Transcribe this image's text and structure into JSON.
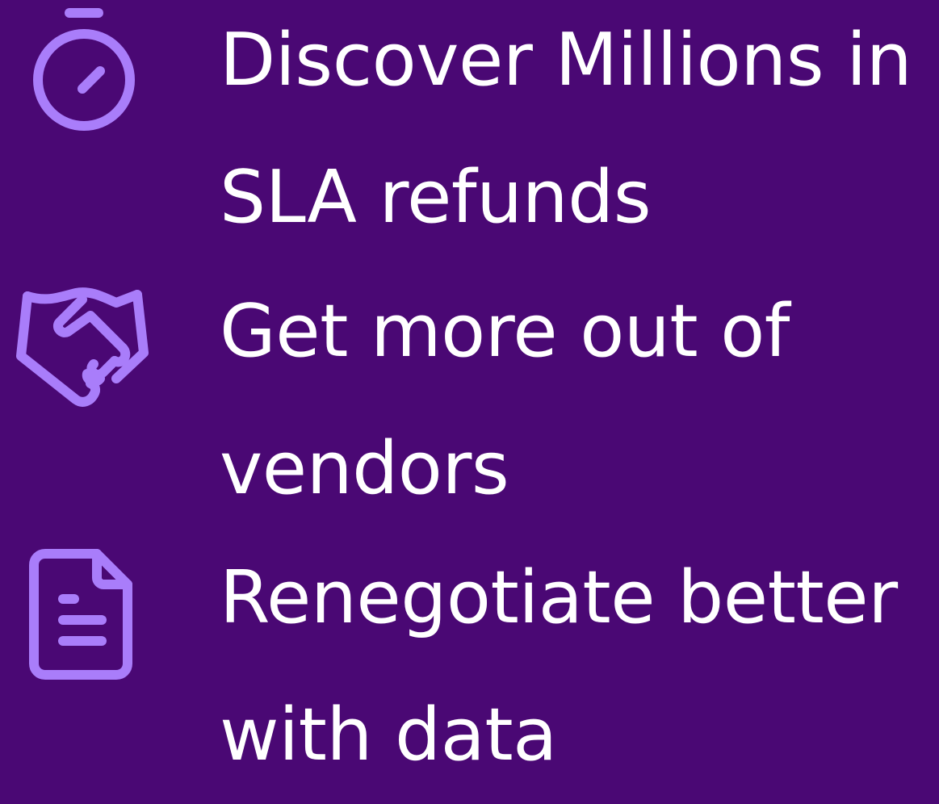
{
  "accent_color": "#a97dfa",
  "background_color": "#4a0874",
  "items": [
    {
      "icon": "stopwatch-icon",
      "line1": "Discover Millions in",
      "line2": "SLA refunds"
    },
    {
      "icon": "handshake-icon",
      "line1": "Get more out of",
      "line2": "vendors"
    },
    {
      "icon": "document-icon",
      "line1": "Renegotiate better",
      "line2": "with data"
    }
  ]
}
